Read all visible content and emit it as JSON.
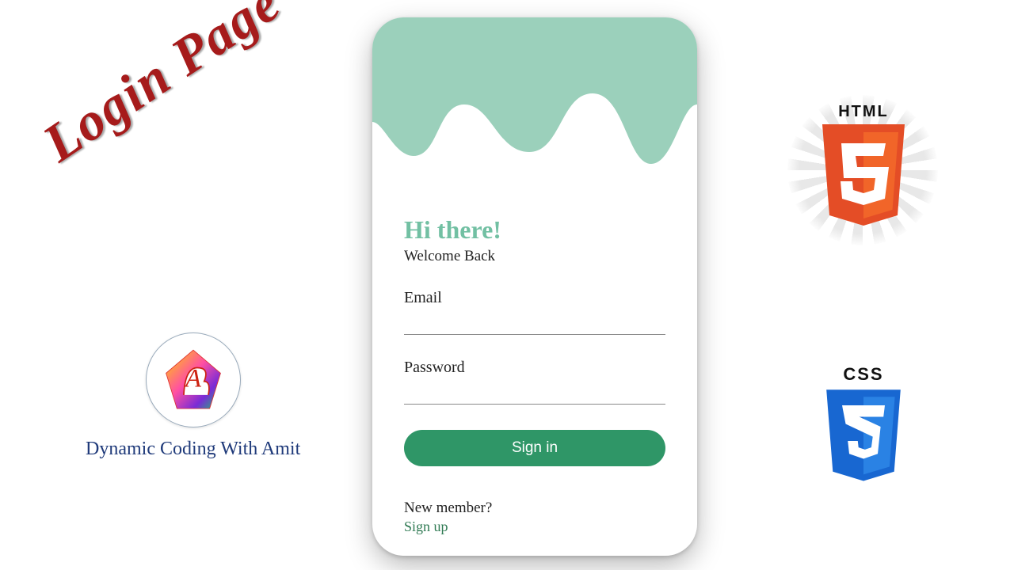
{
  "headline": "Login Page",
  "channel": {
    "caption": "Dynamic Coding With Amit"
  },
  "phone": {
    "greeting": "Hi there!",
    "subgreeting": "Welcome Back",
    "email_label": "Email",
    "email_value": "",
    "password_label": "Password",
    "password_value": "",
    "signin_label": "Sign in",
    "footer_question": "New member?",
    "footer_link": "Sign up",
    "colors": {
      "accent": "#2f9667",
      "wave": "#9bd0bb"
    }
  },
  "badges": {
    "html5": "HTML",
    "css3": "CSS"
  }
}
